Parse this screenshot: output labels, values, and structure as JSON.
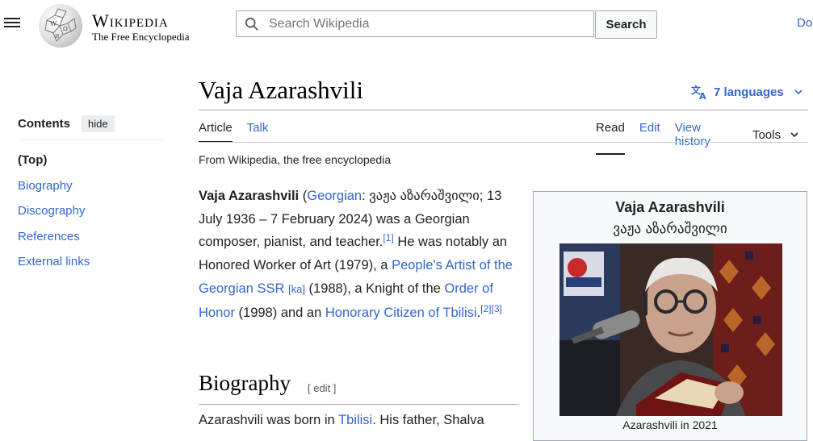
{
  "header": {
    "logo_title": "Wikipedia",
    "logo_subtitle": "The Free Encyclopedia",
    "search_placeholder": "Search Wikipedia",
    "search_button": "Search",
    "right_link": "Do"
  },
  "toc": {
    "title": "Contents",
    "hide_label": "hide",
    "items": [
      {
        "label": "(Top)"
      },
      {
        "label": "Biography"
      },
      {
        "label": "Discography"
      },
      {
        "label": "References"
      },
      {
        "label": "External links"
      }
    ]
  },
  "article": {
    "title": "Vaja Azarashvili",
    "languages": "7 languages",
    "tabs_left": [
      "Article",
      "Talk"
    ],
    "tabs_right": [
      "Read",
      "Edit",
      "View history"
    ],
    "tools": "Tools",
    "tagline": "From Wikipedia, the free encyclopedia",
    "lead": {
      "name": "Vaja Azarashvili",
      "p_open": " (",
      "georgian_link": "Georgian",
      "georgian_name": ": ვაჟა აზარაშვილი; 13 July 1936 – 7 February 2024) was a Georgian composer, pianist, and teacher.",
      "ref1": "[1]",
      "t1": " He was notably an Honored Worker of Art (1979), a ",
      "link_artist": "People's Artist of the Georgian SSR",
      "ka": "[ka]",
      "t2": " (1988), a Knight of the ",
      "link_order": "Order of Honor",
      "t3": " (1998) and an ",
      "link_citizen": "Honorary Citizen of Tbilisi",
      "t4": ".",
      "ref2": "[2]",
      "ref3": "[3]"
    },
    "biography_heading": "Biography",
    "edit_label": "[ edit ]",
    "bio_text": "Azarashvili was born in ",
    "bio_link": "Tbilisi",
    "bio_text2": ". His father, Shalva"
  },
  "infobox": {
    "name": "Vaja Azarashvili",
    "native_name": "ვაჟა აზარაშვილი",
    "caption": "Azarashvili in 2021"
  }
}
